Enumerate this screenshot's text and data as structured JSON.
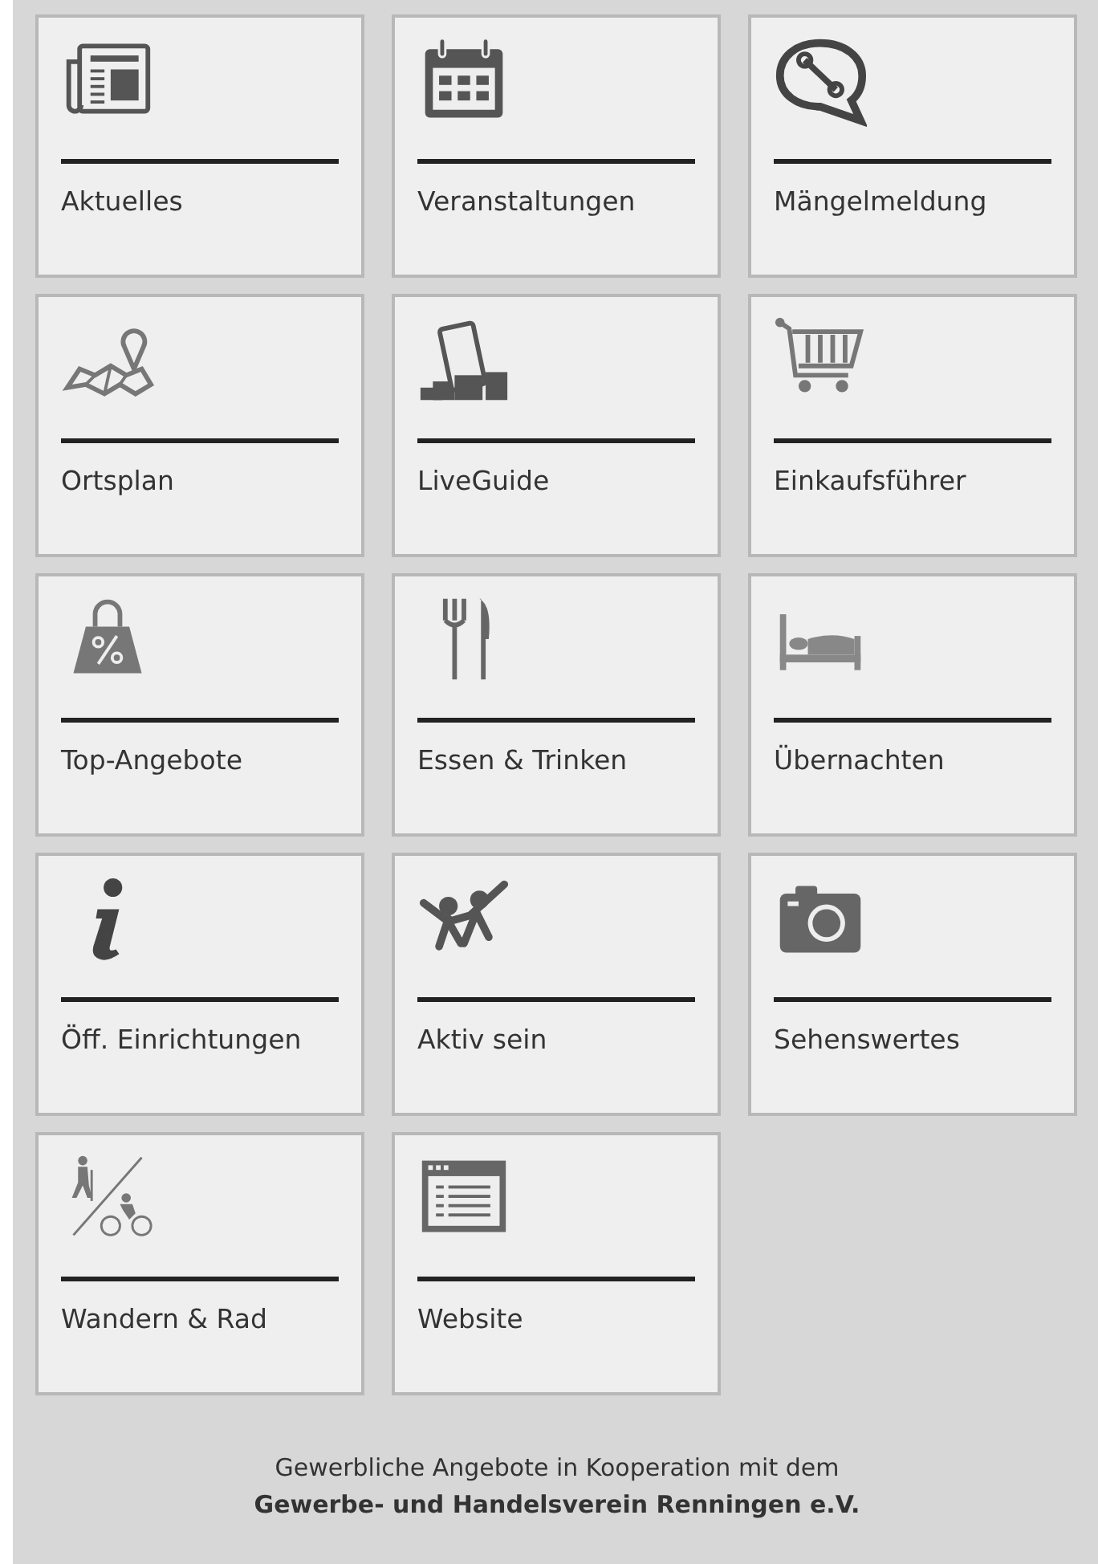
{
  "tiles": [
    {
      "label": "Aktuelles",
      "kind": "newspaper"
    },
    {
      "label": "Veranstaltungen",
      "kind": "calendar"
    },
    {
      "label": "Mängelmeldung",
      "kind": "wrench"
    },
    {
      "label": "Ortsplan",
      "kind": "map"
    },
    {
      "label": "LiveGuide",
      "kind": "liveguide"
    },
    {
      "label": "Einkaufsführer",
      "kind": "cart"
    },
    {
      "label": "Top-Angebote",
      "kind": "bag"
    },
    {
      "label": "Essen & Trinken",
      "kind": "cutlery"
    },
    {
      "label": "Übernachten",
      "kind": "bed"
    },
    {
      "label": "Öff. Einrichtungen",
      "kind": "info"
    },
    {
      "label": "Aktiv sein",
      "kind": "kids"
    },
    {
      "label": "Sehenswertes",
      "kind": "camera"
    },
    {
      "label": "Wandern & Rad",
      "kind": "hikebike"
    },
    {
      "label": "Website",
      "kind": "browser"
    }
  ],
  "footer": "Gewerbliche Angebote in Kooperation mit dem\n**Gewerbe- und Handelsverein Renningen e.V.**"
}
